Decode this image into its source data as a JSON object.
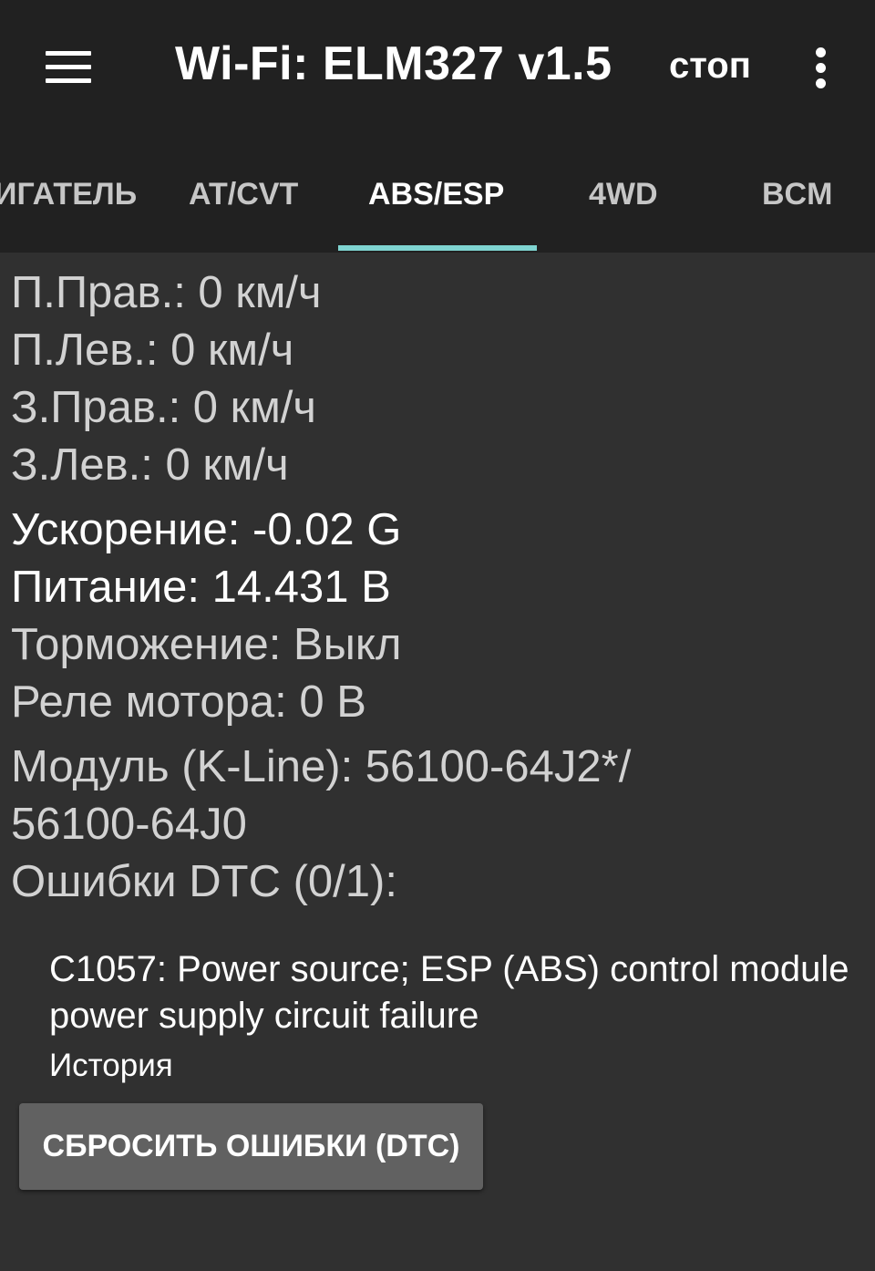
{
  "toolbar": {
    "menu_icon": "menu-icon",
    "title": "Wi-Fi: ELM327 v1.5",
    "stop_label": "стоп",
    "overflow_icon": "more-vertical-icon",
    "background": "#212121"
  },
  "tabs": [
    {
      "label": "ИГАТЕЛЬ",
      "active": false
    },
    {
      "label": "AT/CVT",
      "active": false
    },
    {
      "label": "ABS/ESP",
      "active": true
    },
    {
      "label": "4WD",
      "active": false
    },
    {
      "label": "BCM",
      "active": false
    }
  ],
  "accent_color": "#7fd4d1",
  "readings": {
    "front_right": "П.Прав.: 0 км/ч",
    "front_left": "П.Лев.: 0 км/ч",
    "rear_right": "З.Прав.: 0 км/ч",
    "rear_left": "З.Лев.: 0 км/ч",
    "acceleration": "Ускорение: -0.02 G",
    "power": "Питание: 14.431 В",
    "braking": "Торможение: Выкл",
    "motor_relay": "Реле мотора: 0 В",
    "module_line1": "Модуль (K-Line): 56100-64J2*/",
    "module_line2": "56100-64J0",
    "dtc_header": "Ошибки DTC (0/1):"
  },
  "dtc": {
    "description": "C1057: Power source; ESP (ABS) control module power supply circuit failure",
    "status": "История"
  },
  "reset_button_label": "СБРОСИТЬ ОШИБКИ (DTC)"
}
